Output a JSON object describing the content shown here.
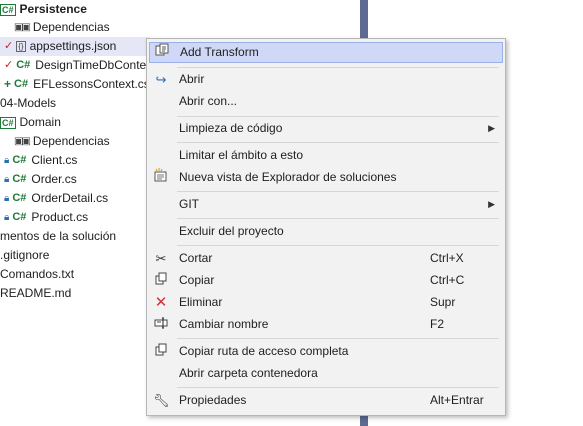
{
  "tree": {
    "project": "Persistence",
    "dependencies": "Dependencias",
    "appsettings": "appsettings.json",
    "design_time": "DesignTimeDbConte",
    "ef_context": "EFLessonsContext.cs",
    "models_folder": "04-Models",
    "domain": "Domain",
    "domain_dependencies": "Dependencias",
    "client": "Client.cs",
    "order": "Order.cs",
    "order_detail": "OrderDetail.cs",
    "product": "Product.cs",
    "solution_items": "mentos de la solución",
    "gitignore": ".gitignore",
    "comandos": "Comandos.txt",
    "readme": "README.md",
    "cs_label": "C#"
  },
  "menu": {
    "add_transform": "Add Transform",
    "abrir": "Abrir",
    "abrir_con": "Abrir con...",
    "limpieza": "Limpieza de código",
    "limitar": "Limitar el ámbito a esto",
    "nueva_vista": "Nueva vista de Explorador de soluciones",
    "git": "GIT",
    "excluir": "Excluir del proyecto",
    "cortar": "Cortar",
    "cortar_key": "Ctrl+X",
    "copiar": "Copiar",
    "copiar_key": "Ctrl+C",
    "eliminar": "Eliminar",
    "eliminar_key": "Supr",
    "cambiar": "Cambiar nombre",
    "cambiar_key": "F2",
    "copiar_ruta": "Copiar ruta de acceso completa",
    "abrir_carpeta": "Abrir carpeta contenedora",
    "propiedades": "Propiedades",
    "propiedades_key": "Alt+Entrar"
  },
  "icons": {
    "submenu_arrow": "chevron-right-icon",
    "colors": {
      "cs_green": "#1f7a3a",
      "lock_blue": "#2a6fb6",
      "delete_red": "#d13438",
      "highlight": "#cfd9f7",
      "divider": "#5e6a91"
    }
  }
}
